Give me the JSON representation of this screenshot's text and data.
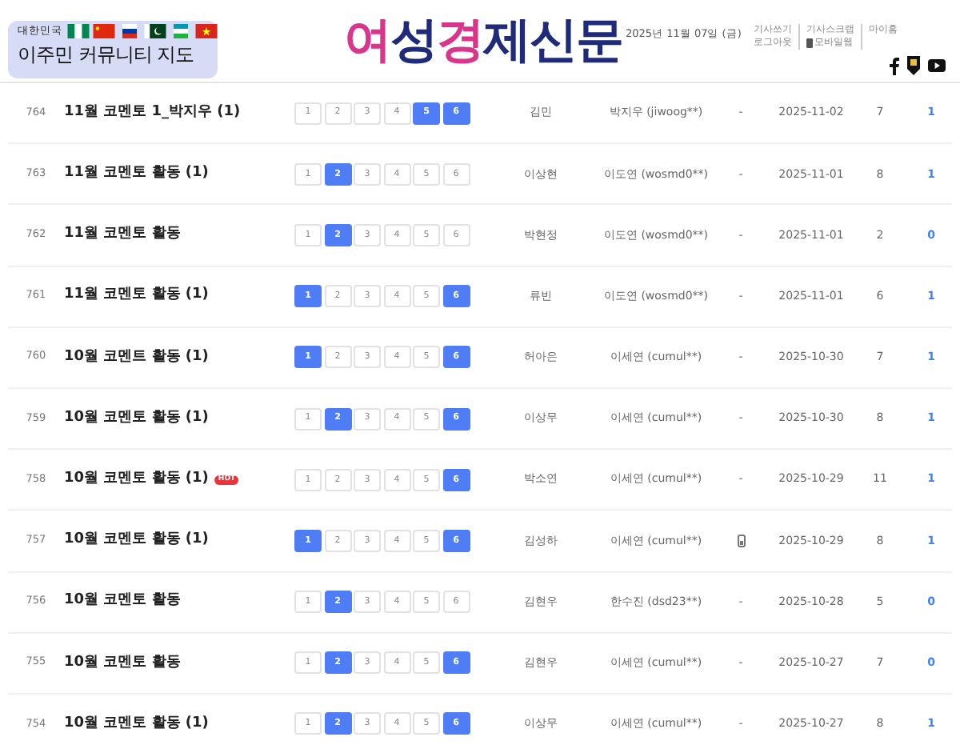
{
  "header": {
    "badge": {
      "country": "대한민국",
      "title": "이주민 커뮤니티 지도"
    },
    "logo": [
      {
        "text": "여",
        "color": "#d9358a"
      },
      {
        "text": "성",
        "color": "#1f2a7a"
      },
      {
        "text": "경",
        "color": "#d9358a"
      },
      {
        "text": "제신문",
        "color": "#1f2a7a"
      }
    ],
    "date": "2025년 11월 07일 (금)",
    "links": [
      {
        "top": "기사쓰기",
        "bottom": "로그아웃"
      },
      {
        "top": "기사스크랩",
        "bottom": "모바일웹"
      },
      {
        "top": "마이홈"
      }
    ]
  },
  "rows": [
    {
      "num": "764",
      "title": "11월 코멘토 1_박지우 (1)",
      "hot": false,
      "pages": [
        {
          "label": "1",
          "selected": false
        },
        {
          "label": "2",
          "selected": false
        },
        {
          "label": "3",
          "selected": false
        },
        {
          "label": "4",
          "selected": false
        },
        {
          "label": "5",
          "selected": true
        },
        {
          "label": "6",
          "selected": true
        }
      ],
      "name": "김민",
      "author": "박지우 (jiwoog**)",
      "file": false,
      "date": "2025-11-02",
      "views": "7",
      "count": "1"
    },
    {
      "num": "763",
      "title": "11월 코멘토 활동 (1)",
      "hot": false,
      "pages": [
        {
          "label": "1",
          "selected": false
        },
        {
          "label": "2",
          "selected": true
        },
        {
          "label": "3",
          "selected": false
        },
        {
          "label": "4",
          "selected": false
        },
        {
          "label": "5",
          "selected": false
        },
        {
          "label": "6",
          "selected": false
        }
      ],
      "name": "이상현",
      "author": "이도연 (wosmd0**)",
      "file": false,
      "date": "2025-11-01",
      "views": "8",
      "count": "1"
    },
    {
      "num": "762",
      "title": "11월 코멘토 활동",
      "hot": false,
      "pages": [
        {
          "label": "1",
          "selected": false
        },
        {
          "label": "2",
          "selected": true
        },
        {
          "label": "3",
          "selected": false
        },
        {
          "label": "4",
          "selected": false
        },
        {
          "label": "5",
          "selected": false
        },
        {
          "label": "6",
          "selected": false
        }
      ],
      "name": "박현정",
      "author": "이도연 (wosmd0**)",
      "file": false,
      "date": "2025-11-01",
      "views": "2",
      "count": "0"
    },
    {
      "num": "761",
      "title": "11월 코멘토 활동 (1)",
      "hot": false,
      "pages": [
        {
          "label": "1",
          "selected": true
        },
        {
          "label": "2",
          "selected": false
        },
        {
          "label": "3",
          "selected": false
        },
        {
          "label": "4",
          "selected": false
        },
        {
          "label": "5",
          "selected": false
        },
        {
          "label": "6",
          "selected": true
        }
      ],
      "name": "류빈",
      "author": "이도연 (wosmd0**)",
      "file": false,
      "date": "2025-11-01",
      "views": "6",
      "count": "1"
    },
    {
      "num": "760",
      "title": "10월 코멘트 활동 (1)",
      "hot": false,
      "pages": [
        {
          "label": "1",
          "selected": true
        },
        {
          "label": "2",
          "selected": false
        },
        {
          "label": "3",
          "selected": false
        },
        {
          "label": "4",
          "selected": false
        },
        {
          "label": "5",
          "selected": false
        },
        {
          "label": "6",
          "selected": true
        }
      ],
      "name": "허아은",
      "author": "이세연 (cumul**)",
      "file": false,
      "date": "2025-10-30",
      "views": "7",
      "count": "1"
    },
    {
      "num": "759",
      "title": "10월 코멘토 활동 (1)",
      "hot": false,
      "pages": [
        {
          "label": "1",
          "selected": false
        },
        {
          "label": "2",
          "selected": true
        },
        {
          "label": "3",
          "selected": false
        },
        {
          "label": "4",
          "selected": false
        },
        {
          "label": "5",
          "selected": false
        },
        {
          "label": "6",
          "selected": true
        }
      ],
      "name": "이상무",
      "author": "이세연 (cumul**)",
      "file": false,
      "date": "2025-10-30",
      "views": "8",
      "count": "1"
    },
    {
      "num": "758",
      "title": "10월 코멘토 활동 (1)",
      "hot": true,
      "pages": [
        {
          "label": "1",
          "selected": false
        },
        {
          "label": "2",
          "selected": false
        },
        {
          "label": "3",
          "selected": false
        },
        {
          "label": "4",
          "selected": false
        },
        {
          "label": "5",
          "selected": false
        },
        {
          "label": "6",
          "selected": true
        }
      ],
      "name": "박소연",
      "author": "이세연 (cumul**)",
      "file": false,
      "date": "2025-10-29",
      "views": "11",
      "count": "1"
    },
    {
      "num": "757",
      "title": "10월 코멘토 활동 (1)",
      "hot": false,
      "pages": [
        {
          "label": "1",
          "selected": true
        },
        {
          "label": "2",
          "selected": false
        },
        {
          "label": "3",
          "selected": false
        },
        {
          "label": "4",
          "selected": false
        },
        {
          "label": "5",
          "selected": false
        },
        {
          "label": "6",
          "selected": true
        }
      ],
      "name": "김성하",
      "author": "이세연 (cumul**)",
      "file": true,
      "date": "2025-10-29",
      "views": "8",
      "count": "1"
    },
    {
      "num": "756",
      "title": "10월 코멘토 활동",
      "hot": false,
      "pages": [
        {
          "label": "1",
          "selected": false
        },
        {
          "label": "2",
          "selected": true
        },
        {
          "label": "3",
          "selected": false
        },
        {
          "label": "4",
          "selected": false
        },
        {
          "label": "5",
          "selected": false
        },
        {
          "label": "6",
          "selected": false
        }
      ],
      "name": "김현우",
      "author": "한수진 (dsd23**)",
      "file": false,
      "date": "2025-10-28",
      "views": "5",
      "count": "0"
    },
    {
      "num": "755",
      "title": "10월 코멘토 활동",
      "hot": false,
      "pages": [
        {
          "label": "1",
          "selected": false
        },
        {
          "label": "2",
          "selected": true
        },
        {
          "label": "3",
          "selected": false
        },
        {
          "label": "4",
          "selected": false
        },
        {
          "label": "5",
          "selected": false
        },
        {
          "label": "6",
          "selected": true
        }
      ],
      "name": "김현우",
      "author": "이세연 (cumul**)",
      "file": false,
      "date": "2025-10-27",
      "views": "7",
      "count": "0"
    },
    {
      "num": "754",
      "title": "10월 코멘토 활동 (1)",
      "hot": false,
      "pages": [
        {
          "label": "1",
          "selected": false
        },
        {
          "label": "2",
          "selected": true
        },
        {
          "label": "3",
          "selected": false
        },
        {
          "label": "4",
          "selected": false
        },
        {
          "label": "5",
          "selected": false
        },
        {
          "label": "6",
          "selected": true
        }
      ],
      "name": "이상무",
      "author": "이세연 (cumul**)",
      "file": false,
      "date": "2025-10-27",
      "views": "8",
      "count": "1"
    }
  ],
  "hot_label": "HOT",
  "file_none": "-"
}
